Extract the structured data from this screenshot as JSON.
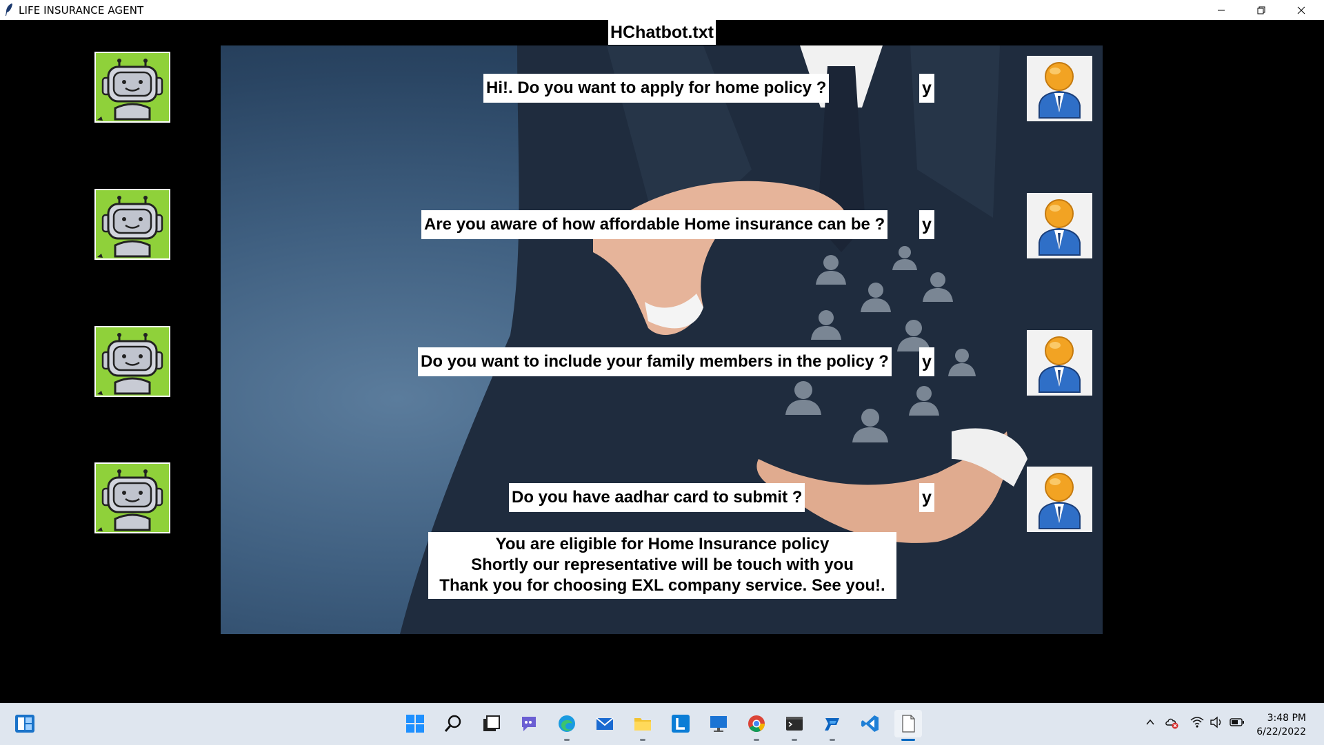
{
  "window": {
    "title": "LIFE INSURANCE AGENT"
  },
  "file_label": "HChatbot.txt",
  "chat": {
    "questions": [
      "Hi!. Do you want to apply for home policy ?",
      "Are you aware of how affordable Home insurance can be ?",
      "Do you want to include your family members in the policy ?",
      "Do you have aadhar card to submit ?"
    ],
    "answers": [
      "y",
      "y",
      "y",
      "y"
    ],
    "final_message": [
      "You are eligible for Home Insurance policy",
      "Shortly our representative will be touch with you",
      "Thank you for choosing EXL company service. See you!."
    ]
  },
  "icons": {
    "bot": "robot-avatar-icon",
    "user": "user-avatar-icon"
  },
  "taskbar": {
    "apps": [
      "start",
      "search",
      "task-view",
      "teams-chat",
      "edge",
      "mail",
      "file-explorer",
      "app-l",
      "remote-desktop",
      "chrome",
      "terminal",
      "power-automate",
      "vscode",
      "notepad"
    ],
    "time": "3:48 PM",
    "date": "6/22/2022"
  },
  "colors": {
    "bot_bg": "#8fd13a",
    "accent": "#0067c0"
  }
}
